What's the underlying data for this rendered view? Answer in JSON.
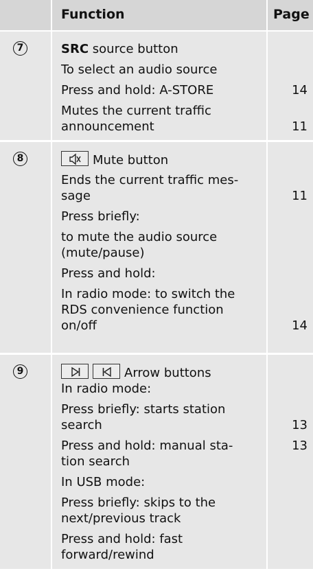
{
  "header": {
    "function": "Function",
    "page": "Page"
  },
  "rows": [
    {
      "number": "7",
      "title_bold": "SRC",
      "title_rest": " source button",
      "lines": [
        "To select an audio source",
        "Press and hold: A-STORE",
        "Mutes the current traffic",
        "announcement"
      ],
      "pages": [
        "14",
        "11"
      ]
    },
    {
      "number": "8",
      "title_rest": "Mute button",
      "title_icons": [
        "mute-speaker-icon"
      ],
      "lines": [
        "Ends the current traffic mes-",
        "sage",
        "Press briefly:",
        "to mute the audio source",
        "(mute/pause)",
        "Press and hold:",
        "In radio mode: to switch the",
        "RDS convenience function",
        "on/off"
      ],
      "pages": [
        "11",
        "14"
      ]
    },
    {
      "number": "9",
      "title_rest": "Arrow buttons",
      "title_icons": [
        "next-track-icon",
        "previous-track-icon"
      ],
      "lines": [
        "In radio mode:",
        "Press briefly: starts station",
        "search",
        "Press and hold: manual sta-",
        "tion search",
        "In USB mode:",
        "Press briefly: skips to the",
        "next/previous track",
        "Press and hold: fast",
        "forward/rewind"
      ],
      "pages": [
        "13",
        "13"
      ]
    }
  ]
}
